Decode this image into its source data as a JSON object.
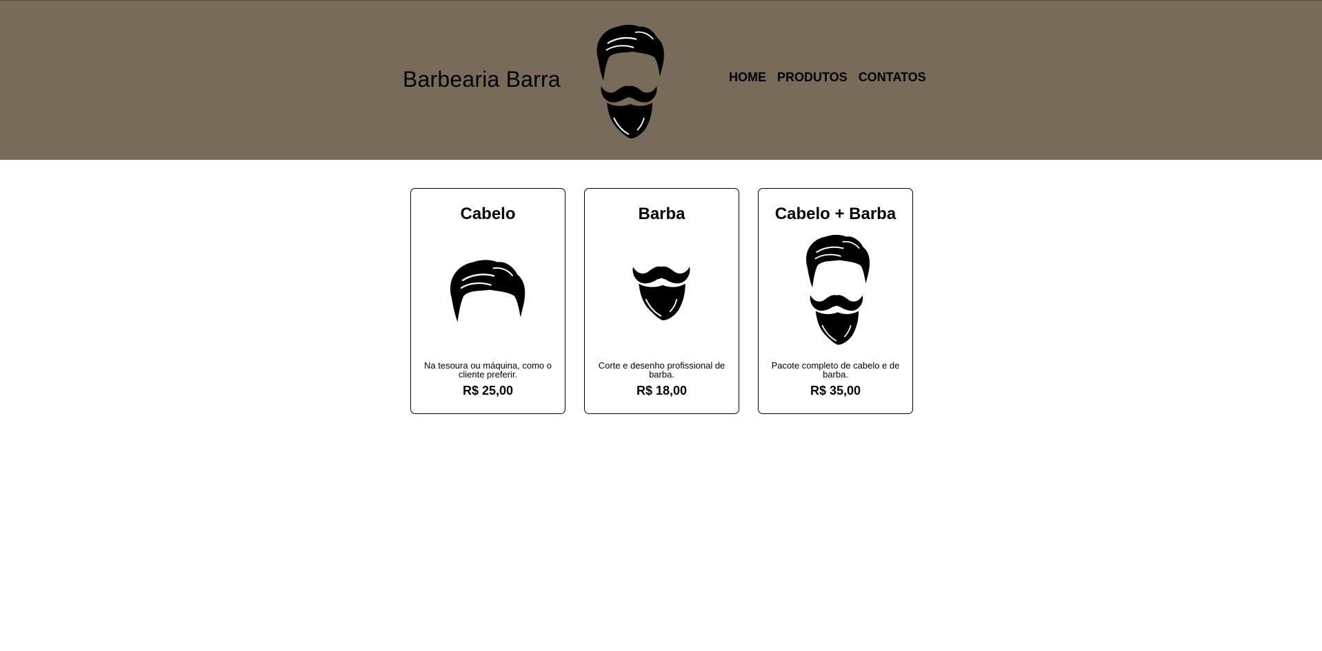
{
  "header": {
    "brand": "Barbearia Barra",
    "logo_icon": "barber-face-icon",
    "background_color": "#786b59",
    "nav": [
      {
        "label": "HOME"
      },
      {
        "label": "PRODUTOS"
      },
      {
        "label": "CONTATOS"
      }
    ]
  },
  "services": [
    {
      "title": "Cabelo",
      "icon": "hair-icon",
      "description": "Na tesoura ou máquina, como o cliente preferir.",
      "price": "R$ 25,00"
    },
    {
      "title": "Barba",
      "icon": "beard-icon",
      "description": "Corte e desenho profissional de barba.",
      "price": "R$ 18,00"
    },
    {
      "title": "Cabelo + Barba",
      "icon": "hair-and-beard-icon",
      "description": "Pacote completo de cabelo e de barba.",
      "price": "R$ 35,00"
    }
  ]
}
